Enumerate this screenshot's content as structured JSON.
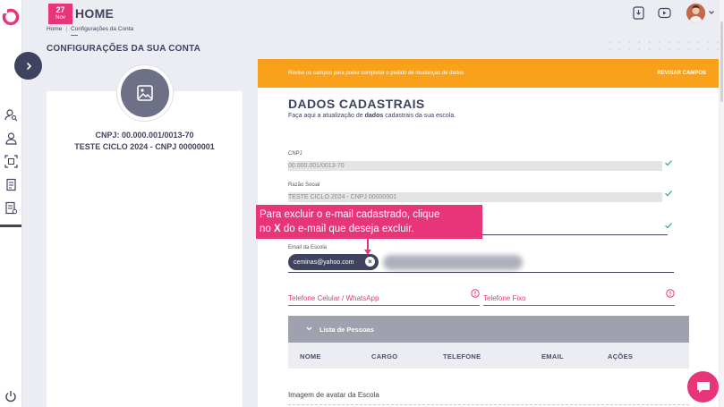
{
  "header": {
    "date_day": "27",
    "date_month": "Nov",
    "title": "HOME",
    "breadcrumb": [
      "Home",
      "Configurações da Conta"
    ],
    "page_title": "CONFIGURAÇÕES DA SUA CONTA"
  },
  "profile": {
    "cnpj": "CNPJ: 00.000.001/0013-70",
    "name": "TESTE CICLO 2024 - CNPJ 00000001"
  },
  "alert": {
    "message": "Revise os campos para poder completar o pedido de mudanças de dados",
    "action": "REVISAR CAMPOS",
    "color": "#f9a11b"
  },
  "form": {
    "title": "DADOS CADASTRAIS",
    "subtitle_pre": "Faça aqui a atualização de ",
    "subtitle_bold": "dados",
    "subtitle_post": " cadastrais da sua escola.",
    "cnpj_label": "CNPJ",
    "cnpj_value": "00.000.001/0013-70",
    "razao_label": "Razão Social",
    "razao_value": "TESTE CICLO 2024 - CNPJ 00000001",
    "email_label": "Email da Escola",
    "email_chip": "ceminas@yahoo.com",
    "celular_label": "Telefone Celular / WhatsApp",
    "fixo_label": "Telefone Fixo"
  },
  "people": {
    "title": "Lista de Pessoas",
    "columns": [
      "NOME",
      "CARGO",
      "TELEFONE",
      "EMAIL",
      "AÇÕES"
    ]
  },
  "avatar_label": "Imagem de avatar da Escola",
  "tooltip": {
    "line1": "Para excluir o e-mail cadastrado, clique",
    "line2_pre": "no ",
    "line2_bold": "X",
    "line2_post": " do e-mail que deseja excluir."
  },
  "colors": {
    "brand": "#e8357a",
    "navy": "#3f4360",
    "valid": "#2fb36a"
  }
}
